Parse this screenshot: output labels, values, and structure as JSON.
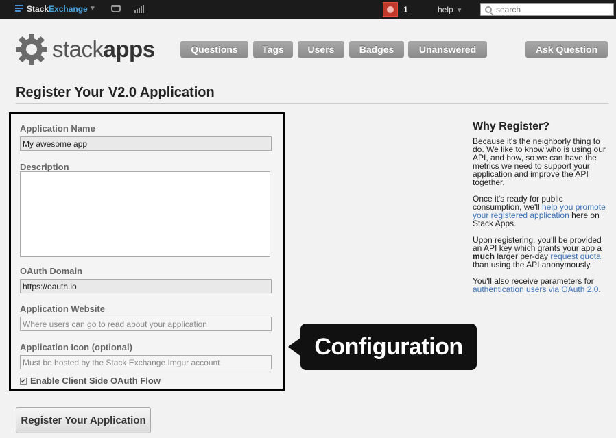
{
  "topbar": {
    "brand_a": "Stack",
    "brand_b": "Exchange",
    "rep": "1",
    "help": "help",
    "search_placeholder": "search"
  },
  "header": {
    "logo_light": "stack",
    "logo_bold": "apps",
    "nav": [
      "Questions",
      "Tags",
      "Users",
      "Badges",
      "Unanswered"
    ],
    "ask": "Ask Question"
  },
  "page": {
    "title": "Register Your V2.0 Application"
  },
  "form": {
    "app_name_label": "Application Name",
    "app_name_value": "My awesome app",
    "description_label": "Description",
    "oauth_label": "OAuth Domain",
    "oauth_value": "https://oauth.io",
    "website_label": "Application Website",
    "website_placeholder": "Where users can go to read about your application",
    "icon_label": "Application Icon (optional)",
    "icon_placeholder": "Must be hosted by the Stack Exchange Imgur account",
    "client_side_label": "Enable Client Side OAuth Flow",
    "client_side_checked": true,
    "submit": "Register Your Application"
  },
  "callout": {
    "text": "Configuration"
  },
  "sidebar": {
    "title": "Why Register?",
    "p1": "Because it's the neighborly thing to do. We like to know who is using our API, and how, so we can have the metrics we need to support your application and improve the API together.",
    "p2_a": "Once it's ready for public consumption, we'll ",
    "p2_link": "help you promote your registered application",
    "p2_b": " here on Stack Apps.",
    "p3_a": "Upon registering, you'll be provided an API key which grants your app a ",
    "p3_bold": "much",
    "p3_b": " larger per-day ",
    "p3_link": "request quota",
    "p3_c": " than using the API anonymously.",
    "p4_a": "You'll also receive parameters for ",
    "p4_link": "authentication users via OAuth 2.0",
    "p4_b": "."
  },
  "colors": {
    "link": "#3b73b9",
    "nav_button": "#999999",
    "topbar": "#1b1b1b"
  }
}
